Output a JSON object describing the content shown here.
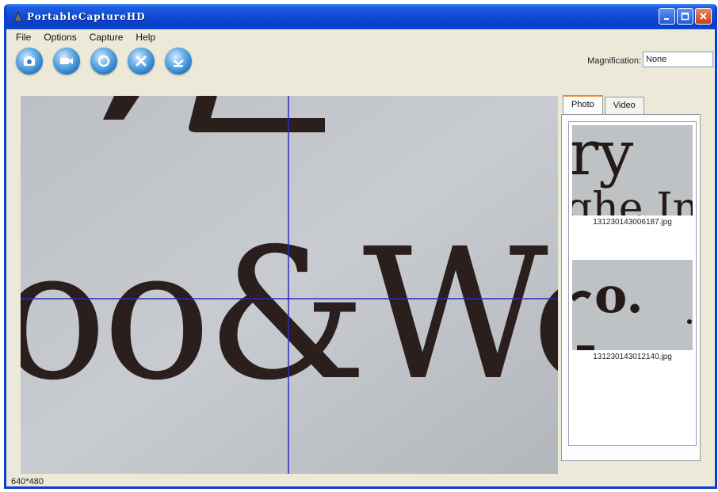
{
  "window": {
    "title": "PortableCaptureHD"
  },
  "menu": [
    "File",
    "Options",
    "Capture",
    "Help"
  ],
  "toolbar": {
    "buttons": [
      {
        "name": "capture-photo-icon"
      },
      {
        "name": "record-video-icon"
      },
      {
        "name": "power-icon"
      },
      {
        "name": "settings-icon"
      },
      {
        "name": "save-icon"
      }
    ],
    "magnification_label": "Magnification:",
    "magnification_value": "None"
  },
  "viewer": {
    "preview_text": "oo&Wo"
  },
  "side_panel": {
    "tabs": [
      "Photo",
      "Video"
    ],
    "active_tab": "Photo",
    "thumbnails": [
      {
        "filename": "131230143006187.jpg",
        "preview_text": "ry"
      },
      {
        "filename": "131230143012140.jpg",
        "preview_text": "o."
      }
    ]
  },
  "status": {
    "resolution": "640*480"
  },
  "colors": {
    "titlebar": "#0f4ad6",
    "crosshair": "#2b2bc8",
    "ink": "#2a1f1c"
  }
}
